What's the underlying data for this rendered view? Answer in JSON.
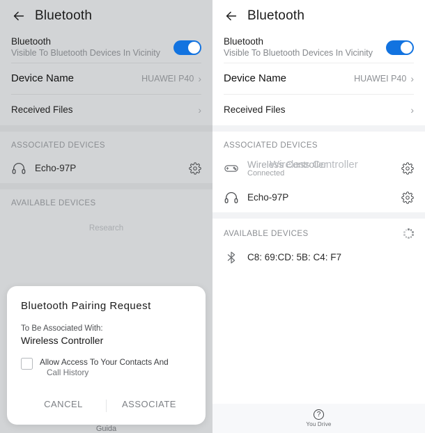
{
  "screens": [
    {
      "id": "left",
      "header": {
        "title": "Bluetooth",
        "back_icon": "back-arrow-icon"
      },
      "bluetooth_row": {
        "title": "Bluetooth",
        "subtitle": "Visible To Bluetooth Devices In Vicinity",
        "toggle_on": true,
        "toggle_color": "#1273e0"
      },
      "device_name_row": {
        "label": "Device Name",
        "value": "HUAWEI P40",
        "chevron": "›"
      },
      "received_files_row": {
        "label": "Received Files",
        "chevron": "›"
      },
      "associated": {
        "header": "ASSOCIATED DEVICES",
        "devices": [
          {
            "name": "Echo-97P",
            "sub": "",
            "icon": "headphones-icon",
            "gear": "gear-icon"
          }
        ]
      },
      "available": {
        "header": "AVAILABLE DEVICES",
        "search_label": "Research",
        "devices": []
      },
      "dialog": {
        "title": "Bluetooth Pairing Request",
        "associate_label": "To Be Associated With:",
        "device_name": "Wireless Controller",
        "checkbox_checked": false,
        "checkbox_line1": "Allow Access To Your Contacts And",
        "checkbox_line2": "Call History",
        "cancel_label": "CANCEL",
        "associate_button_label": "ASSOCIATE"
      },
      "bottom_label": "Guida"
    },
    {
      "id": "right",
      "header": {
        "title": "Bluetooth",
        "back_icon": "back-arrow-icon"
      },
      "bluetooth_row": {
        "title": "Bluetooth",
        "subtitle": "Visible To Bluetooth Devices In Vicinity",
        "toggle_on": true,
        "toggle_color": "#1273e0"
      },
      "device_name_row": {
        "label": "Device Name",
        "value": "HUAWEI P40",
        "chevron": "›"
      },
      "received_files_row": {
        "label": "Received Files",
        "chevron": "›"
      },
      "associated": {
        "header": "ASSOCIATED DEVICES",
        "devices": [
          {
            "name": "Wireless Controller",
            "sub": "Connected",
            "icon": "gamepad-icon",
            "gear": "gear-icon"
          },
          {
            "name": "Echo-97P",
            "sub": "",
            "icon": "headphones-icon",
            "gear": "gear-icon"
          }
        ]
      },
      "available": {
        "header": "AVAILABLE DEVICES",
        "scanning": true,
        "devices": [
          {
            "name": "C8: 69:CD: 5B: C4: F7",
            "icon": "bluetooth-icon"
          }
        ]
      },
      "footer": {
        "icon": "question-mark-icon",
        "label": "You Drive"
      }
    }
  ]
}
